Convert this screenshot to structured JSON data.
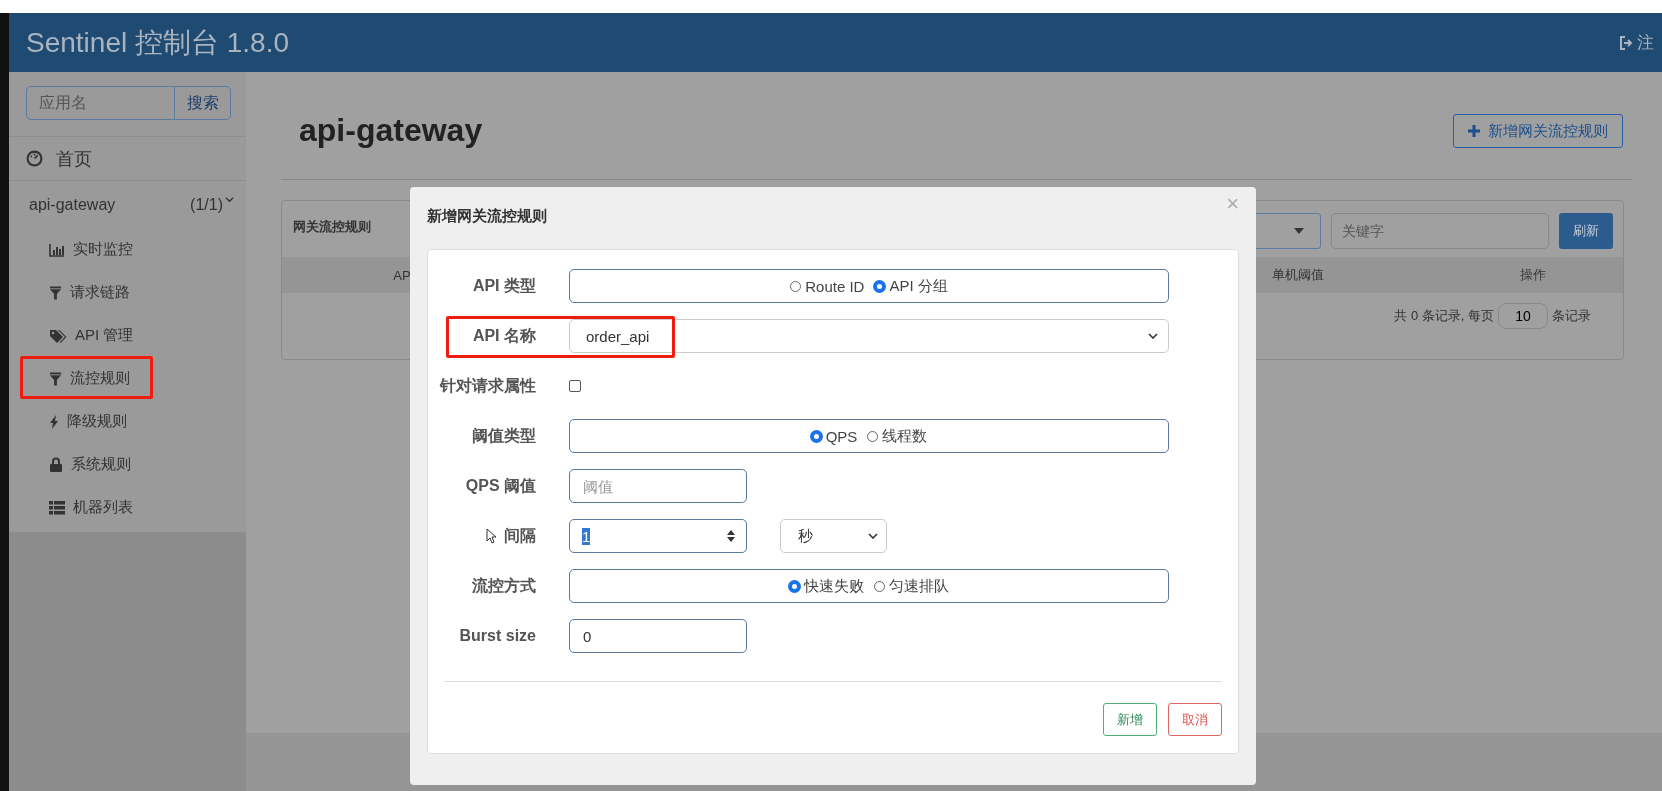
{
  "header": {
    "title": "Sentinel 控制台 1.8.0",
    "logout": "注"
  },
  "sidebar": {
    "search": {
      "placeholder": "应用名",
      "button": "搜索"
    },
    "home": "首页",
    "app": {
      "name": "api-gateway",
      "count": "(1/1)",
      "expanded": true,
      "items": [
        {
          "label": "实时监控",
          "kind": "chart",
          "highlighted": false
        },
        {
          "label": "请求链路",
          "kind": "filter",
          "highlighted": false
        },
        {
          "label": "API 管理",
          "kind": "tag",
          "highlighted": false
        },
        {
          "label": "流控规则",
          "kind": "filter",
          "highlighted": true
        },
        {
          "label": "降级规则",
          "kind": "bolt",
          "highlighted": false
        },
        {
          "label": "系统规则",
          "kind": "lock",
          "highlighted": false
        },
        {
          "label": "机器列表",
          "kind": "list",
          "highlighted": false
        }
      ]
    }
  },
  "main": {
    "title": "api-gateway",
    "add_button": "新增网关流控规则",
    "panel": {
      "title": "网关流控规则",
      "keyword_placeholder": "关键字",
      "refresh": "刷新",
      "columns": [
        "AP",
        "单机阈值",
        "操作"
      ],
      "pagination": {
        "before": "共 0 条记录, 每页",
        "page_size": "10",
        "after": "条记录"
      }
    }
  },
  "dialog": {
    "title": "新增网关流控规则",
    "close": "×",
    "rows": [
      {
        "kind": "radio",
        "label": "API 类型",
        "options": [
          {
            "label": "Route ID",
            "selected": false
          },
          {
            "label": "API 分组",
            "selected": true
          }
        ]
      },
      {
        "kind": "select",
        "label": "API 名称",
        "value": "order_api",
        "highlighted": true
      },
      {
        "kind": "checkbox",
        "label": "针对请求属性",
        "checked": false
      },
      {
        "kind": "radio",
        "label": "阈值类型",
        "options": [
          {
            "label": "QPS",
            "selected": true
          },
          {
            "label": "线程数",
            "selected": false
          }
        ]
      },
      {
        "kind": "input",
        "label": "QPS 阈值",
        "placeholder": "阈值"
      },
      {
        "kind": "interval",
        "label": "间隔",
        "value": "1",
        "unit": "秒"
      },
      {
        "kind": "radio",
        "label": "流控方式",
        "options": [
          {
            "label": "快速失败",
            "selected": true
          },
          {
            "label": "匀速排队",
            "selected": false
          }
        ]
      },
      {
        "kind": "input",
        "label": "Burst size",
        "value": "0"
      }
    ],
    "buttons": [
      {
        "label": "新增",
        "kind": "confirm"
      },
      {
        "label": "取消",
        "kind": "cancel"
      }
    ]
  }
}
